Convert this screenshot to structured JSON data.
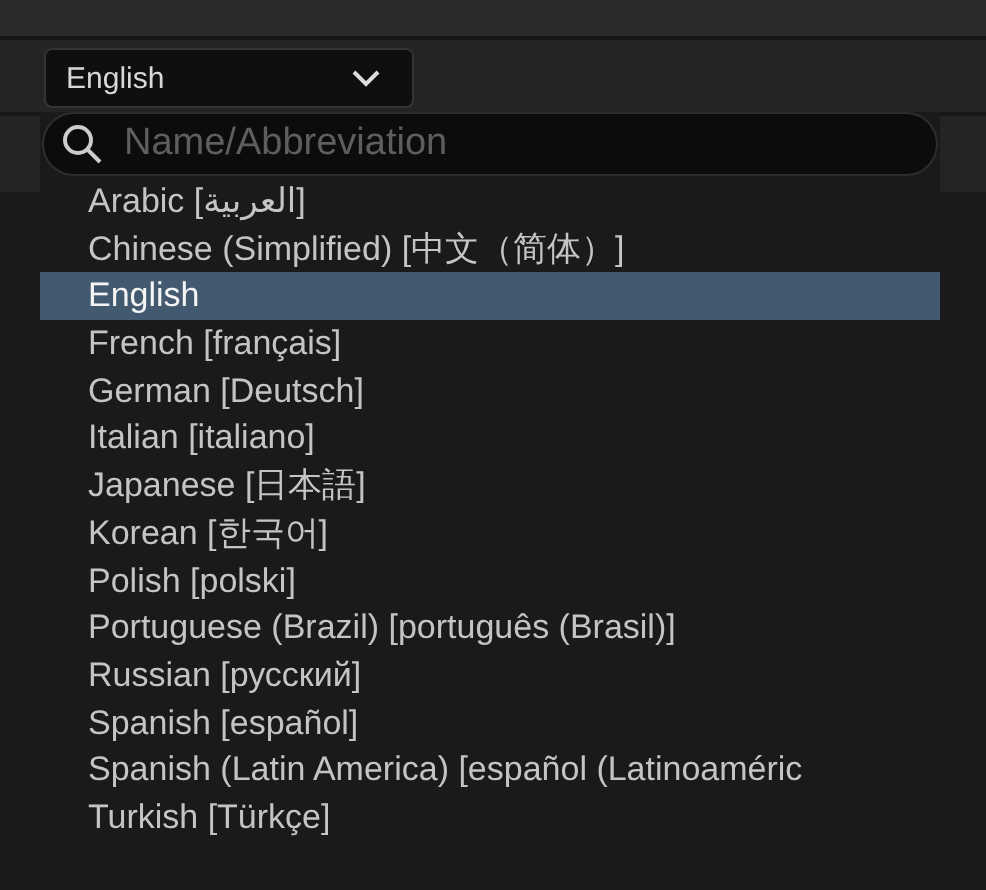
{
  "dropdown": {
    "value": "English"
  },
  "search": {
    "placeholder": "Name/Abbreviation"
  },
  "languages": [
    {
      "label": "Arabic [العربية]",
      "selected": false
    },
    {
      "label": "Chinese (Simplified) [中文（简体）]",
      "selected": false
    },
    {
      "label": "English",
      "selected": true
    },
    {
      "label": "French [français]",
      "selected": false
    },
    {
      "label": "German [Deutsch]",
      "selected": false
    },
    {
      "label": "Italian [italiano]",
      "selected": false
    },
    {
      "label": "Japanese [日本語]",
      "selected": false
    },
    {
      "label": "Korean [한국어]",
      "selected": false
    },
    {
      "label": "Polish [polski]",
      "selected": false
    },
    {
      "label": "Portuguese (Brazil) [português (Brasil)]",
      "selected": false
    },
    {
      "label": "Russian [русский]",
      "selected": false
    },
    {
      "label": "Spanish [español]",
      "selected": false
    },
    {
      "label": "Spanish (Latin America) [español (Latinoaméric",
      "selected": false
    },
    {
      "label": "Turkish [Türkçe]",
      "selected": false
    }
  ]
}
